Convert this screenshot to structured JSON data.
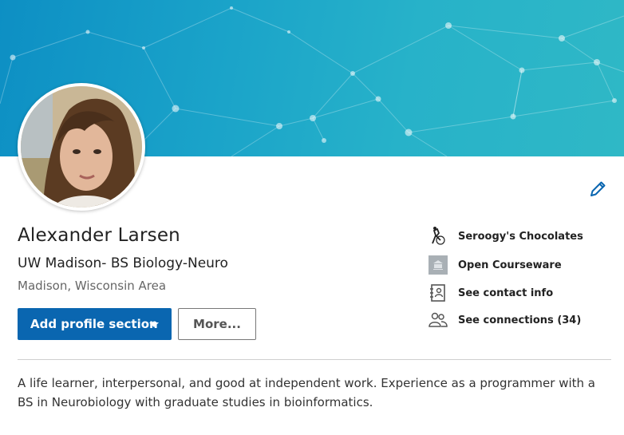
{
  "profile": {
    "name": "Alexander Larsen",
    "headline": "UW Madison- BS Biology-Neuro",
    "location": "Madison, Wisconsin Area",
    "summary": "A life learner, interpersonal, and good at independent work. Experience as a programmer with a BS in Neurobiology with graduate studies in bioinformatics."
  },
  "actions": {
    "add_section_label": "Add profile section",
    "more_label": "More..."
  },
  "side": {
    "items": [
      {
        "label": "Seroogy's Chocolates",
        "icon": "company-logo-icon"
      },
      {
        "label": "Open Courseware",
        "icon": "school-icon"
      },
      {
        "label": "See contact info",
        "icon": "contact-card-icon"
      },
      {
        "label": "See connections (34)",
        "icon": "connections-icon"
      }
    ]
  },
  "colors": {
    "banner": "#1aa3c9",
    "primary_button": "#0a66b0",
    "edit_icon": "#0a66b0"
  }
}
